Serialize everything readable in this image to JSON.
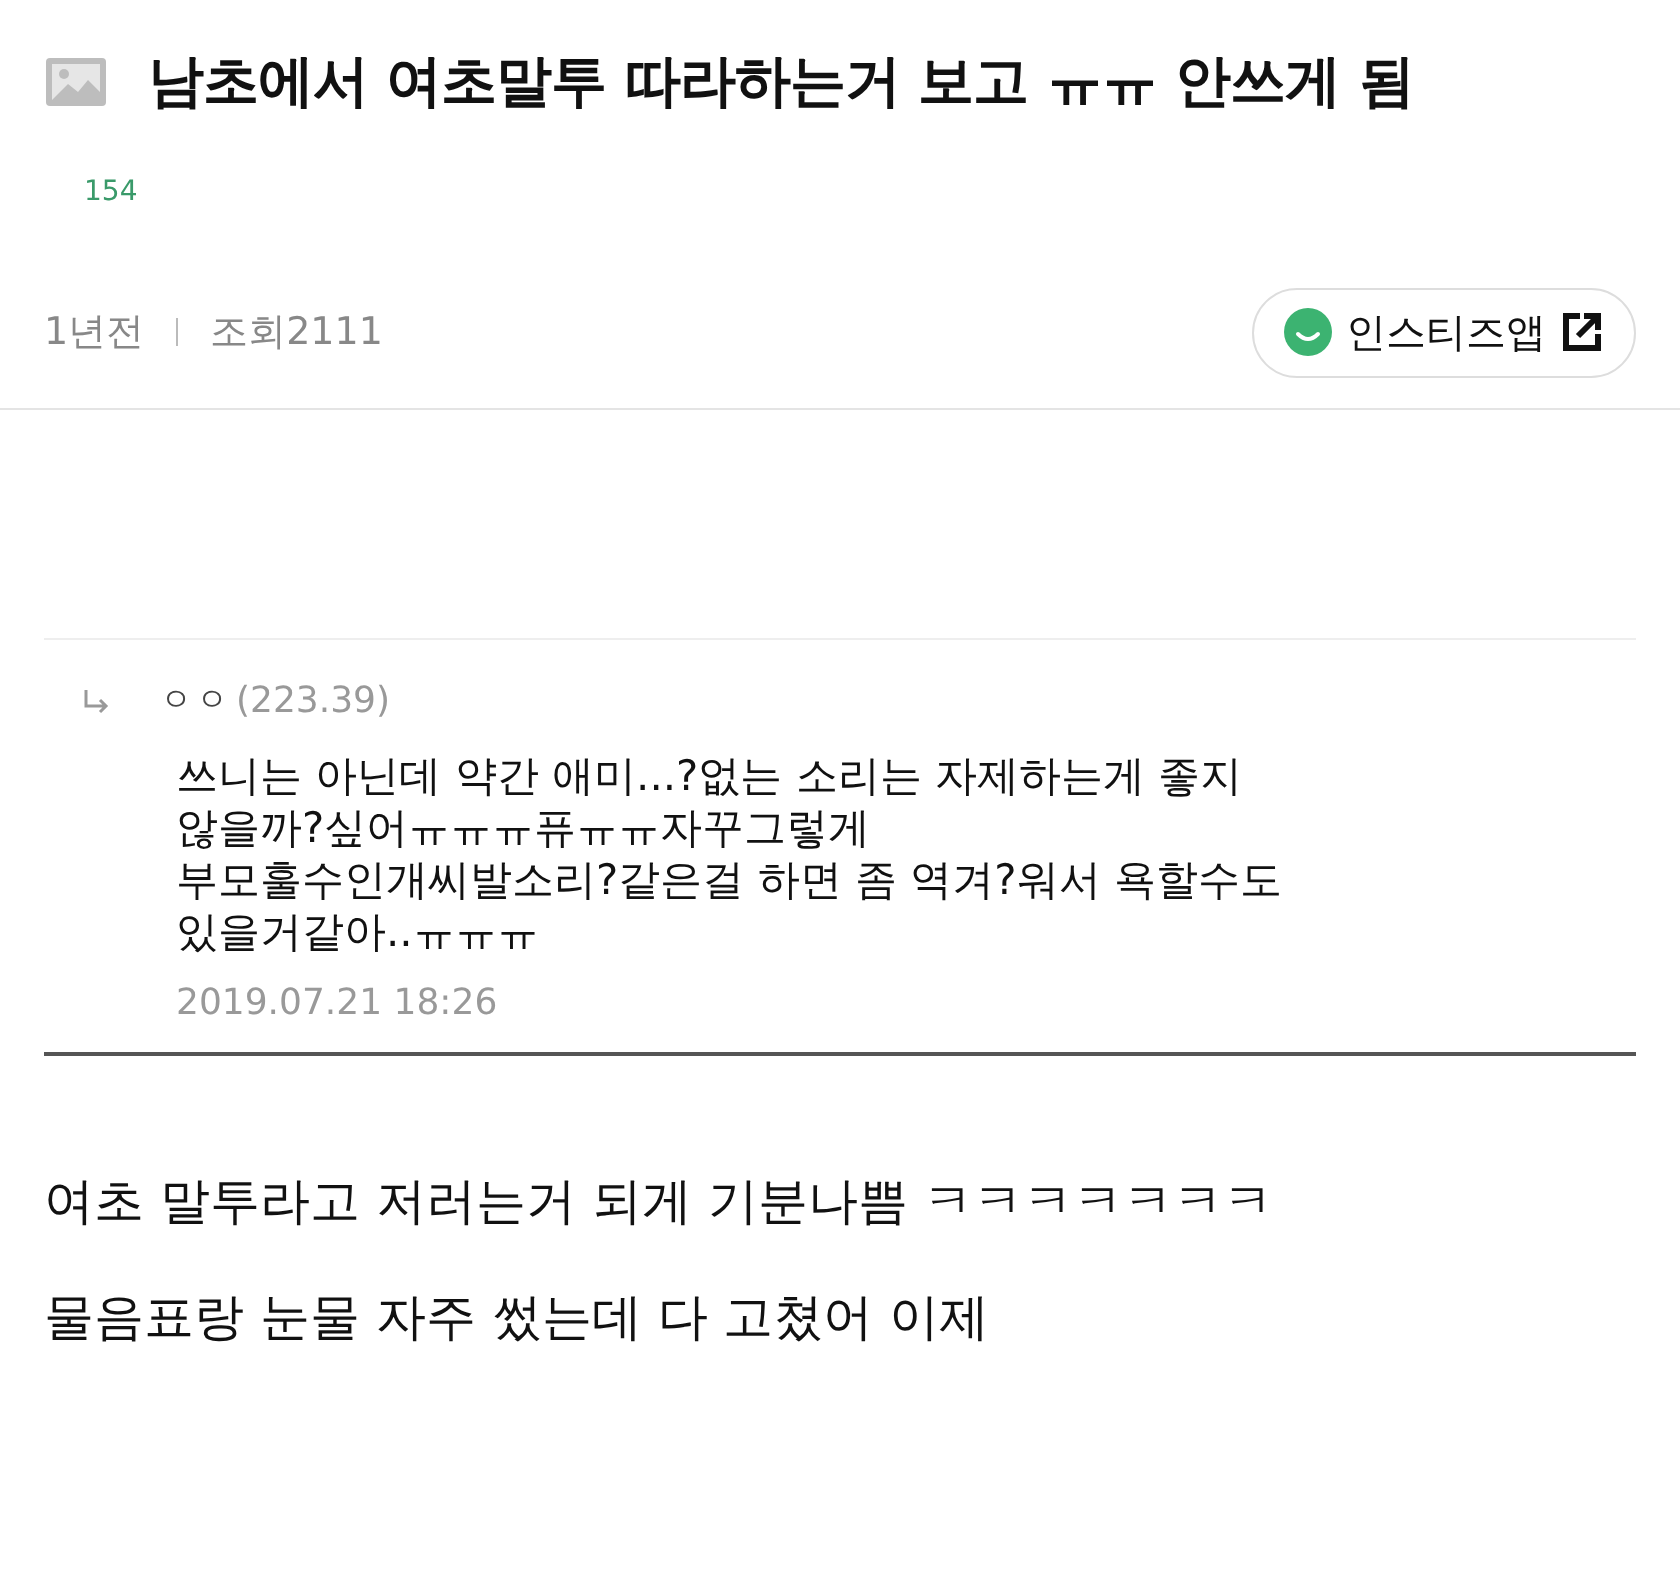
{
  "post": {
    "title": "남초에서 여초말투 따라하는거 보고 ㅠㅠ 안쓰게 됨",
    "count": "154",
    "time": "1년전",
    "views": "조회2111",
    "app_button": "인스티즈앱"
  },
  "comment": {
    "author": "ㅇㅇ",
    "ip": "(223.39)",
    "text": "쓰니는 아닌데 약간 애미...?없는 소리는 자제하는게 좋지\n않을까?싶어ㅠㅠㅠ퓨ㅠㅠ자꾸그렇게\n부모훌수인개씨발소리?같은걸 하면 좀 역겨?워서 욕할수도\n있을거같아..ㅠㅠㅠ",
    "date": "2019.07.21 18:26"
  },
  "body": [
    "여초 말투라고 저러는거 되게 기분나쁨 ㅋㅋㅋㅋㅋㅋㅋ",
    "물음표랑 눈물 자주 썼는데 다 고쳤어 이제"
  ]
}
